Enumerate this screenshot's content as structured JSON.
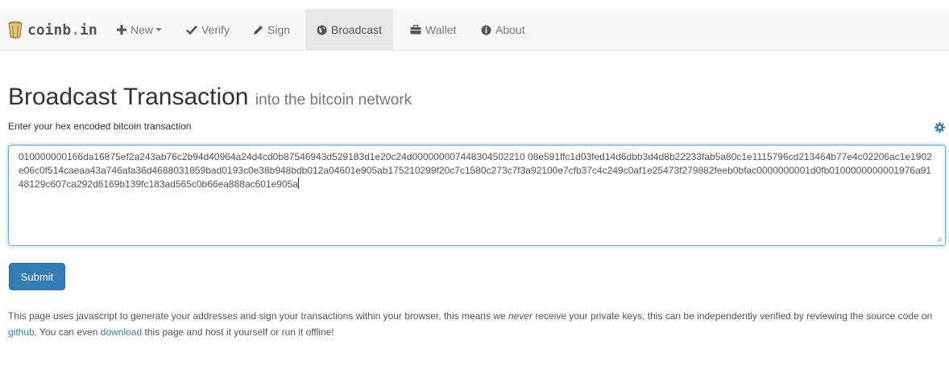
{
  "navbar": {
    "brand": {
      "part1": "coinb",
      "dot": ".",
      "part2": "in",
      "logo": "bucket-icon"
    },
    "items": [
      {
        "label": "New",
        "icon": "plus-icon",
        "dropdown": true
      },
      {
        "label": "Verify",
        "icon": "check-icon"
      },
      {
        "label": "Sign",
        "icon": "pencil-icon"
      },
      {
        "label": "Broadcast",
        "icon": "globe-icon",
        "active": true
      },
      {
        "label": "Wallet",
        "icon": "briefcase-icon"
      },
      {
        "label": "About",
        "icon": "info-icon"
      }
    ]
  },
  "main": {
    "title": "Broadcast Transaction",
    "subtitle": "into the bitcoin network",
    "field_label": "Enter your hex encoded bitcoin transaction",
    "settings_icon": "gear-icon",
    "hex_value": "010000000166da16875ef2a243ab76c2b94d40964a24d4cd0b87546943d529183d1e20c24d000000007448304502210 08e591ffc1d03fed14d6dbb3d4d8b22233fab5a80c1e1115796cd213464b77e4c02206ac1e1902e06c0f514caeaa43a746afa36d4688031859bad0193c0e38b948bdb012a04601e905ab175210299f20c7c1580c273c7f3a92100e7cfb37c4c249c0af1e25473f279882feeb0bfac0000000001d0fb0100000000001976a9148129c607ca292d6169b139fc183ad565c0b66ea888ac601e905a",
    "submit_label": "Submit",
    "info": {
      "part1": "This page uses javascript to generate your addresses and sign your transactions within your browser, this means we ",
      "emphasis": "never",
      "part2": " receive your private keys, this can be independently verified by reviewing the source code on ",
      "link1": "github",
      "part3": ". You can even ",
      "link2": "download",
      "part4": " this page and host it yourself or run it offline!"
    }
  },
  "colors": {
    "primary": "#337ab7",
    "navbar_bg": "#f8f8f8",
    "active_tab": "#e7e7e7",
    "focus_border": "#66afe9"
  }
}
